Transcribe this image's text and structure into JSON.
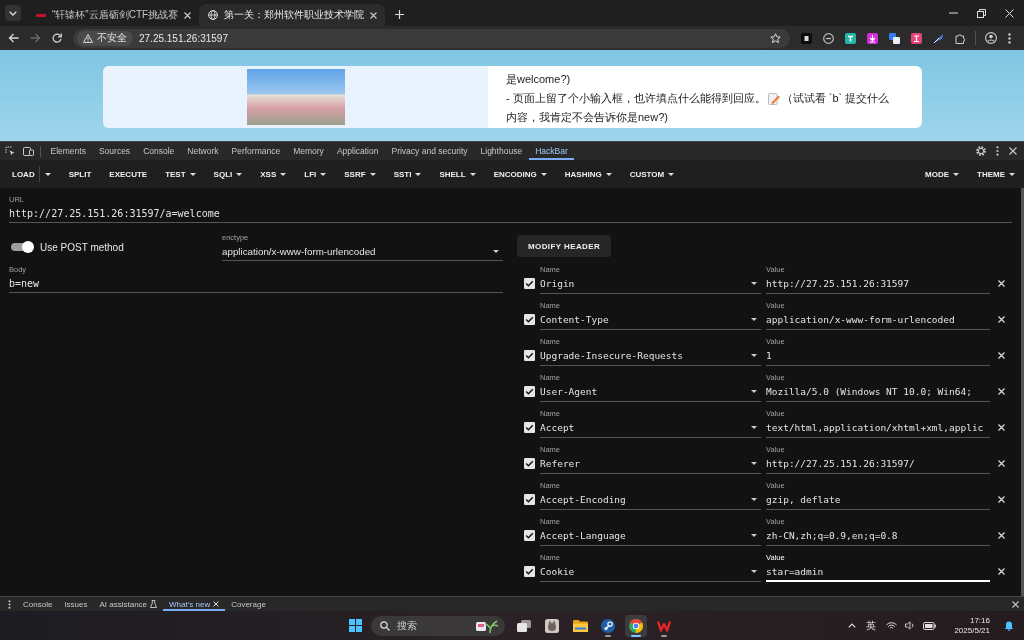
{
  "browser": {
    "tabs": [
      {
        "title": "“轩辕杯”云盾砺剑CTF挑战赛",
        "kind": "logo",
        "selected": false
      },
      {
        "title": "第一关：郑州软件职业技术学院",
        "kind": "globe",
        "selected": true
      }
    ],
    "navigation": {
      "back_disabled": false,
      "forward_disabled": true
    },
    "omnibox": {
      "security_label": "不安全",
      "url": "27.25.151.26:31597"
    }
  },
  "page": {
    "hint_line": "是welcome?)",
    "hint": {
      "before": "- 页面上留了个小输入框，也许填点什么能得到回应。",
      "after": "（试试看 `b` 提交什么"
    },
    "hint_wrap": "内容，我肯定不会告诉你是new?)"
  },
  "devtools": {
    "tabs": [
      {
        "label": "Elements",
        "selected": false
      },
      {
        "label": "Sources",
        "selected": false
      },
      {
        "label": "Console",
        "selected": false
      },
      {
        "label": "Network",
        "selected": false
      },
      {
        "label": "Performance",
        "selected": false
      },
      {
        "label": "Memory",
        "selected": false
      },
      {
        "label": "Application",
        "selected": false
      },
      {
        "label": "Privacy and security",
        "selected": false
      },
      {
        "label": "Lighthouse",
        "selected": false
      },
      {
        "label": "HackBar",
        "selected": true
      }
    ]
  },
  "hackbar": {
    "menu": [
      {
        "label": "LOAD",
        "kind": "split"
      },
      {
        "label": "SPLIT",
        "kind": "plain"
      },
      {
        "label": "EXECUTE",
        "kind": "plain"
      },
      {
        "label": "TEST",
        "kind": "dropdown"
      },
      {
        "label": "SQLI",
        "kind": "dropdown"
      },
      {
        "label": "XSS",
        "kind": "dropdown"
      },
      {
        "label": "LFI",
        "kind": "dropdown"
      },
      {
        "label": "SSRF",
        "kind": "dropdown"
      },
      {
        "label": "SSTI",
        "kind": "dropdown"
      },
      {
        "label": "SHELL",
        "kind": "dropdown"
      },
      {
        "label": "ENCODING",
        "kind": "dropdown"
      },
      {
        "label": "HASHING",
        "kind": "dropdown"
      },
      {
        "label": "CUSTOM",
        "kind": "dropdown"
      }
    ],
    "menu_right": [
      {
        "label": "MODE",
        "kind": "dropdown"
      },
      {
        "label": "THEME",
        "kind": "dropdown"
      }
    ],
    "url": {
      "label": "URL",
      "value": "http://27.25.151.26:31597/a=welcome"
    },
    "post": {
      "label": "Use POST method",
      "on": true
    },
    "enctype": {
      "label": "enctype",
      "value": "application/x-www-form-urlencoded"
    },
    "body": {
      "label": "Body",
      "value": "b=new"
    },
    "modify_header": "MODIFY HEADER",
    "headers": [
      {
        "name_label": "Name",
        "name": "Origin",
        "value_label": "Value",
        "value": "http://27.25.151.26:31597",
        "checked": true,
        "focused": false
      },
      {
        "name_label": "Name",
        "name": "Content-Type",
        "value_label": "Value",
        "value": "application/x-www-form-urlencoded",
        "checked": true,
        "focused": false
      },
      {
        "name_label": "Name",
        "name": "Upgrade-Insecure-Requests",
        "value_label": "Value",
        "value": "1",
        "checked": true,
        "focused": false
      },
      {
        "name_label": "Name",
        "name": "User-Agent",
        "value_label": "Value",
        "value": "Mozilla/5.0 (Windows NT 10.0; Win64;",
        "checked": true,
        "focused": false
      },
      {
        "name_label": "Name",
        "name": "Accept",
        "value_label": "Value",
        "value": "text/html,application/xhtml+xml,applic",
        "checked": true,
        "focused": false
      },
      {
        "name_label": "Name",
        "name": "Referer",
        "value_label": "Value",
        "value": "http://27.25.151.26:31597/",
        "checked": true,
        "focused": false
      },
      {
        "name_label": "Name",
        "name": "Accept-Encoding",
        "value_label": "Value",
        "value": "gzip, deflate",
        "checked": true,
        "focused": false
      },
      {
        "name_label": "Name",
        "name": "Accept-Language",
        "value_label": "Value",
        "value": "zh-CN,zh;q=0.9,en;q=0.8",
        "checked": true,
        "focused": false
      },
      {
        "name_label": "Name",
        "name": "Cookie",
        "value_label": "Value",
        "value": "star=admin",
        "checked": true,
        "focused": true
      }
    ]
  },
  "drawer": {
    "tabs": [
      {
        "label": "Console",
        "kind": "plain",
        "selected": false
      },
      {
        "label": "Issues",
        "kind": "plain",
        "selected": false
      },
      {
        "label": "AI assistance",
        "kind": "experimental",
        "selected": false
      },
      {
        "label": "What's new",
        "kind": "closable",
        "selected": true
      },
      {
        "label": "Coverage",
        "kind": "plain",
        "selected": false
      }
    ]
  },
  "taskbar": {
    "search": {
      "placeholder": "搜索"
    },
    "apps": [
      {
        "kind": "task_view",
        "running": false,
        "selected": false
      },
      {
        "kind": "picture_app",
        "running": false,
        "selected": false
      },
      {
        "kind": "folder",
        "running": false,
        "selected": false
      },
      {
        "kind": "game_store",
        "running": true,
        "selected": false
      },
      {
        "kind": "browser",
        "running": true,
        "selected": true
      },
      {
        "kind": "office",
        "running": true,
        "selected": false
      }
    ],
    "language": "英",
    "time": "17:16",
    "date": "2025/5/21"
  }
}
